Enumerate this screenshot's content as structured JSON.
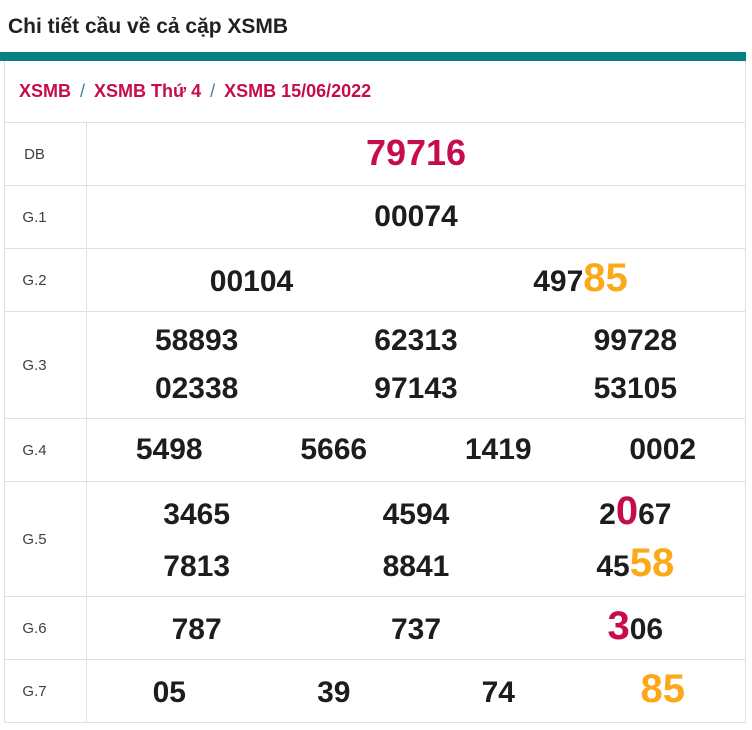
{
  "title": "Chi tiết cầu về cả cặp XSMB",
  "breadcrumb": {
    "separator": "/",
    "items": [
      "XSMB",
      "XSMB Thứ 4",
      "XSMB 15/06/2022"
    ]
  },
  "colors": {
    "accent_teal": "#087e85",
    "crimson": "#c60c4e",
    "orange": "#fba919",
    "separator_blue": "#4a7fa6",
    "number_ink": "#1d1d1d",
    "border": "#e0e0e0"
  },
  "table": {
    "rows": [
      {
        "label": "DB",
        "lines": [
          [
            {
              "parts": [
                {
                  "text": "79716",
                  "color": "crimson",
                  "size": "db"
                }
              ]
            }
          ]
        ]
      },
      {
        "label": "G.1",
        "lines": [
          [
            {
              "parts": [
                {
                  "text": "00074"
                }
              ]
            }
          ]
        ]
      },
      {
        "label": "G.2",
        "lines": [
          [
            {
              "parts": [
                {
                  "text": "00104"
                }
              ]
            },
            {
              "parts": [
                {
                  "text": "497"
                },
                {
                  "text": "85",
                  "color": "orange",
                  "size": "big"
                }
              ]
            }
          ]
        ]
      },
      {
        "label": "G.3",
        "lines": [
          [
            {
              "parts": [
                {
                  "text": "58893"
                }
              ]
            },
            {
              "parts": [
                {
                  "text": "62313"
                }
              ]
            },
            {
              "parts": [
                {
                  "text": "99728"
                }
              ]
            }
          ],
          [
            {
              "parts": [
                {
                  "text": "02338"
                }
              ]
            },
            {
              "parts": [
                {
                  "text": "97143"
                }
              ]
            },
            {
              "parts": [
                {
                  "text": "53105"
                }
              ]
            }
          ]
        ]
      },
      {
        "label": "G.4",
        "lines": [
          [
            {
              "parts": [
                {
                  "text": "5498"
                }
              ]
            },
            {
              "parts": [
                {
                  "text": "5666"
                }
              ]
            },
            {
              "parts": [
                {
                  "text": "1419"
                }
              ]
            },
            {
              "parts": [
                {
                  "text": "0002"
                }
              ]
            }
          ]
        ]
      },
      {
        "label": "G.5",
        "lines": [
          [
            {
              "parts": [
                {
                  "text": "3465"
                }
              ]
            },
            {
              "parts": [
                {
                  "text": "4594"
                }
              ]
            },
            {
              "parts": [
                {
                  "text": "2"
                },
                {
                  "text": "0",
                  "color": "crimson",
                  "size": "big"
                },
                {
                  "text": "67"
                }
              ]
            }
          ],
          [
            {
              "parts": [
                {
                  "text": "7813"
                }
              ]
            },
            {
              "parts": [
                {
                  "text": "8841"
                }
              ]
            },
            {
              "parts": [
                {
                  "text": "45"
                },
                {
                  "text": "58",
                  "color": "orange",
                  "size": "big"
                }
              ]
            }
          ]
        ]
      },
      {
        "label": "G.6",
        "lines": [
          [
            {
              "parts": [
                {
                  "text": "787"
                }
              ]
            },
            {
              "parts": [
                {
                  "text": "737"
                }
              ]
            },
            {
              "parts": [
                {
                  "text": "3",
                  "color": "crimson",
                  "size": "big"
                },
                {
                  "text": "06"
                }
              ]
            }
          ]
        ]
      },
      {
        "label": "G.7",
        "lines": [
          [
            {
              "parts": [
                {
                  "text": "05"
                }
              ]
            },
            {
              "parts": [
                {
                  "text": "39"
                }
              ]
            },
            {
              "parts": [
                {
                  "text": "74"
                }
              ]
            },
            {
              "parts": [
                {
                  "text": "85",
                  "color": "orange",
                  "size": "big"
                }
              ]
            }
          ]
        ]
      }
    ]
  }
}
